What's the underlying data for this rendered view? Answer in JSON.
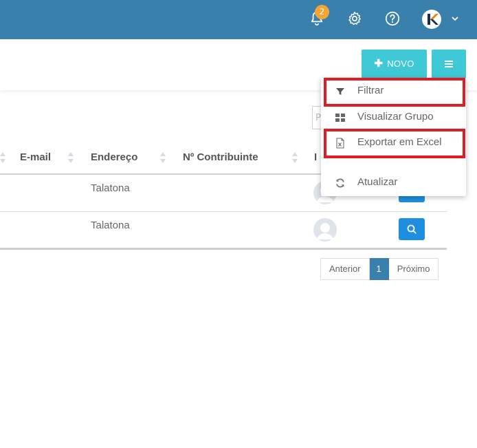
{
  "topbar": {
    "notification_count": "2",
    "icons": [
      "bell-icon",
      "gear-icon",
      "help-icon",
      "avatar",
      "chevron-down-icon"
    ],
    "bg_color": "#3a80ad",
    "badge_color": "#f3a534"
  },
  "header": {
    "new_button_label": "NOVO",
    "menu_button_icon": "hamburger-icon",
    "accent_color": "#3fc9d6"
  },
  "search": {
    "placeholder_fragment": "P"
  },
  "table": {
    "columns": [
      "E-mail",
      "Endereço",
      "Nº Contribuinte",
      "I"
    ],
    "rows": [
      {
        "email": "",
        "address": "Talatona",
        "contributor": ""
      },
      {
        "email": "",
        "address": "Talatona",
        "contributor": ""
      }
    ]
  },
  "pagination": {
    "previous": "Anterior",
    "current": "1",
    "next": "Próximo"
  },
  "dropdown": {
    "items": [
      {
        "label": "Filtrar",
        "icon": "filter-icon"
      },
      {
        "label": "Visualizar Grupo",
        "icon": "grid-icon"
      },
      {
        "label": "Exportar em Excel",
        "icon": "excel-file-icon"
      },
      {
        "label": "Atualizar",
        "icon": "refresh-icon"
      }
    ],
    "highlight_color": "#e01b22"
  }
}
